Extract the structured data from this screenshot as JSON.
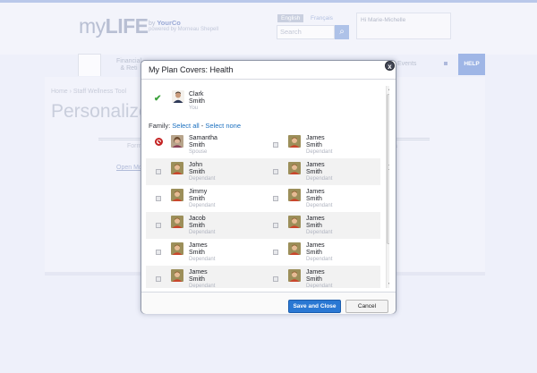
{
  "background": {
    "logo_light": "my",
    "logo_bold": "LIFE",
    "logo_by": "by",
    "logo_company": "YourCo",
    "logo_powered": "powered by Morneau Shepell",
    "lang_active": "English",
    "lang_other": "Français",
    "search_placeholder": "Search",
    "user_label": "Hi Marie-Michelle",
    "nav_financial_line1": "Financial",
    "nav_financial_line2": "& Reti",
    "nav_events": "Events",
    "help_label": "HELP",
    "breadcrumb": "Home  ›  Staff Wellness Tool",
    "page_title": "Personalize Yo",
    "form_label": "Form",
    "right_label": "a",
    "open_link": "Open Mo"
  },
  "modal": {
    "title": "My Plan Covers: Health",
    "close_label": "x",
    "self": {
      "first": "Clark",
      "last": "Smith",
      "role": "You"
    },
    "family_label": "Family:",
    "select_all": "Select all",
    "separator": "-",
    "select_none": "Select none",
    "members": [
      {
        "first": "Samantha",
        "last": "Smith",
        "role": "Spouse",
        "status": "excluded",
        "avatar": "female"
      },
      {
        "first": "James",
        "last": "Smith",
        "role": "Dependant",
        "status": "unchecked",
        "avatar": "male"
      },
      {
        "first": "John",
        "last": "Smith",
        "role": "Dependant",
        "status": "unchecked",
        "avatar": "male"
      },
      {
        "first": "James",
        "last": "Smith",
        "role": "Dependant",
        "status": "unchecked",
        "avatar": "male"
      },
      {
        "first": "Jimmy",
        "last": "Smith",
        "role": "Dependant",
        "status": "unchecked",
        "avatar": "male"
      },
      {
        "first": "James",
        "last": "Smith",
        "role": "Dependant",
        "status": "unchecked",
        "avatar": "male"
      },
      {
        "first": "Jacob",
        "last": "Smith",
        "role": "Dependant",
        "status": "unchecked",
        "avatar": "male"
      },
      {
        "first": "James",
        "last": "Smith",
        "role": "Dependant",
        "status": "unchecked",
        "avatar": "male"
      },
      {
        "first": "James",
        "last": "Smith",
        "role": "Dependant",
        "status": "unchecked",
        "avatar": "male"
      },
      {
        "first": "James",
        "last": "Smith",
        "role": "Dependant",
        "status": "unchecked",
        "avatar": "male"
      },
      {
        "first": "James",
        "last": "Smith",
        "role": "Dependant",
        "status": "unchecked",
        "avatar": "male"
      },
      {
        "first": "James",
        "last": "Smith",
        "role": "Dependant",
        "status": "unchecked",
        "avatar": "male"
      }
    ],
    "save_label": "Save and Close",
    "cancel_label": "Cancel"
  },
  "colors": {
    "accent": "#2a78d3",
    "check": "#3ba13b",
    "excluded": "#c42424",
    "overlay": "#eef0fa"
  }
}
